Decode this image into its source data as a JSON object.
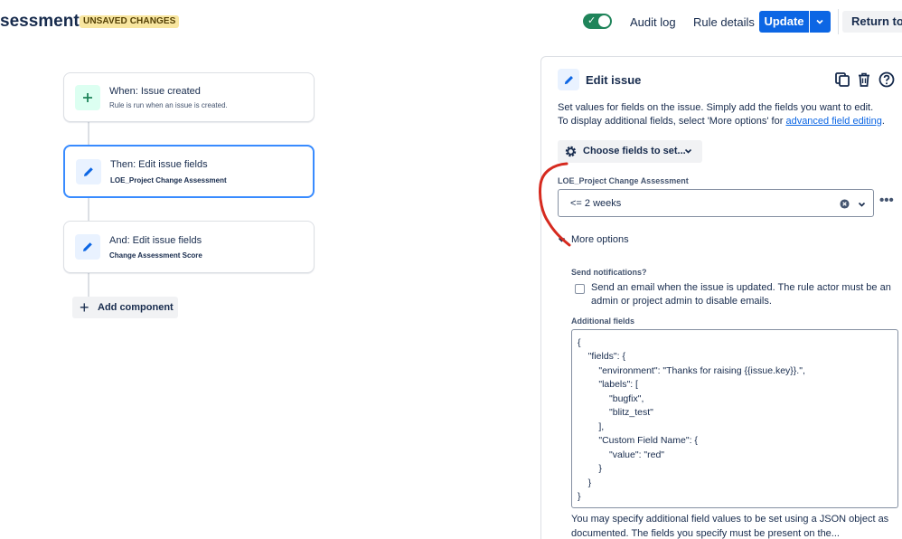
{
  "header": {
    "title": "sessment",
    "badge": "UNSAVED CHANGES",
    "toggle_enabled": true,
    "audit_log": "Audit log",
    "rule_details": "Rule details",
    "update": "Update",
    "return": "Return to ru"
  },
  "flow": {
    "trigger": {
      "title": "When: Issue created",
      "subtitle": "Rule is run when an issue is created."
    },
    "action1": {
      "title": "Then: Edit issue fields",
      "subtitle": "LOE_Project Change Assessment"
    },
    "action2": {
      "title": "And: Edit issue fields",
      "subtitle": "Change Assessment Score"
    },
    "add_component": "Add component"
  },
  "panel": {
    "title": "Edit issue",
    "desc_line1": "Set values for fields on the issue. Simply add the fields you want to edit.",
    "desc_line2_prefix": "To display additional fields, select 'More options' for ",
    "desc_line2_link": "advanced field editing",
    "desc_line2_suffix": ".",
    "choose_fields": "Choose fields to set...",
    "field_label": "LOE_Project Change Assessment",
    "field_value": "<= 2 weeks",
    "more_options": "More options",
    "send_label": "Send notifications?",
    "send_text_line1": "Send an email when the issue is updated. The rule actor must be an",
    "send_text_line2": "admin or project admin to disable emails.",
    "additional_label": "Additional fields",
    "json_lines": [
      "{",
      "    \"fields\": {",
      "        \"environment\": \"Thanks for raising {{issue.key}}.\",",
      "        \"labels\": [",
      "            \"bugfix\",",
      "            \"blitz_test\"",
      "        ],",
      "        \"Custom Field Name\": {",
      "            \"value\": \"red\"",
      "        }",
      "    }",
      "}"
    ],
    "help_line1": "You may specify additional field values to be set using a JSON object as",
    "help_line2": "documented. The fields you specify must be present on the..."
  },
  "colors": {
    "primary": "#0c66e4",
    "toggle_on": "#1f845a",
    "badge_bg": "#f8e6a0",
    "selected_border": "#388bff",
    "annotation": "#d62a1f"
  },
  "icons": {
    "trigger": "plus-icon",
    "action": "pencil-icon",
    "panel": "pencil-icon",
    "duplicate": "copy-icon",
    "delete": "trash-icon",
    "help": "question-icon",
    "settings": "gear-icon"
  }
}
